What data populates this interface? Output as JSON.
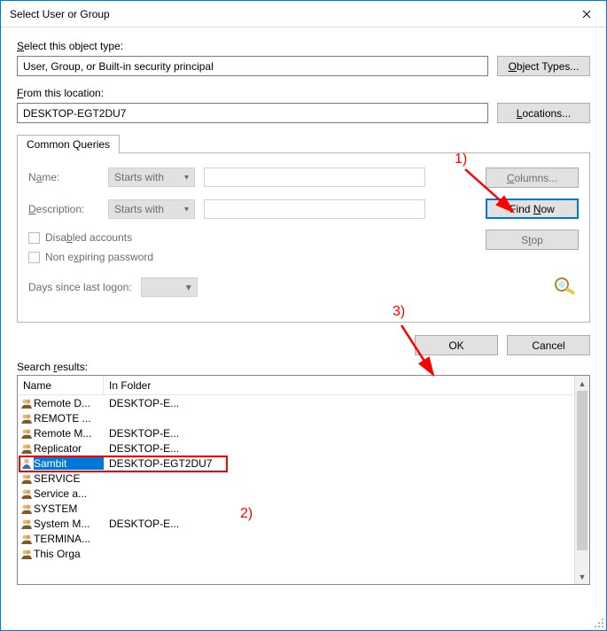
{
  "window": {
    "title": "Select User or Group"
  },
  "labels": {
    "object_type_pre": "S",
    "object_type_rest": "elect this object type:",
    "location_pre": "F",
    "location_rest": "rom this location:",
    "results_pre": "Search ",
    "results_u": "r",
    "results_rest": "esults:"
  },
  "fields": {
    "object_type_value": "User, Group, or Built-in security principal",
    "location_value": "DESKTOP-EGT2DU7"
  },
  "buttons": {
    "object_types": "Object Types...",
    "locations": "Locations...",
    "columns": "Columns...",
    "find_now": "Find Now",
    "stop": "Stop",
    "ok": "OK",
    "cancel": "Cancel"
  },
  "tab": {
    "label": "Common Queries"
  },
  "queries": {
    "name_label": "Name:",
    "desc_label": "Description:",
    "starts_with": "Starts with",
    "disabled": "Disabled accounts",
    "nonexpire": "Non expiring password",
    "days_logon": "Days since last logon:"
  },
  "columns": {
    "name": "Name",
    "in_folder": "In Folder"
  },
  "results": [
    {
      "icon": "group",
      "name": "Remote D...",
      "folder": "DESKTOP-E..."
    },
    {
      "icon": "group",
      "name": "REMOTE ...",
      "folder": ""
    },
    {
      "icon": "group",
      "name": "Remote M...",
      "folder": "DESKTOP-E..."
    },
    {
      "icon": "group",
      "name": "Replicator",
      "folder": "DESKTOP-E..."
    },
    {
      "icon": "user",
      "name": "Sambit",
      "folder": "DESKTOP-EGT2DU7",
      "selected": true
    },
    {
      "icon": "group",
      "name": "SERVICE",
      "folder": ""
    },
    {
      "icon": "group",
      "name": "Service a...",
      "folder": ""
    },
    {
      "icon": "group",
      "name": "SYSTEM",
      "folder": ""
    },
    {
      "icon": "group",
      "name": "System M...",
      "folder": "DESKTOP-E..."
    },
    {
      "icon": "group",
      "name": "TERMINA...",
      "folder": ""
    },
    {
      "icon": "group",
      "name": "This Orga",
      "folder": ""
    }
  ],
  "annotations": {
    "one": "1)",
    "two": "2)",
    "three": "3)"
  }
}
